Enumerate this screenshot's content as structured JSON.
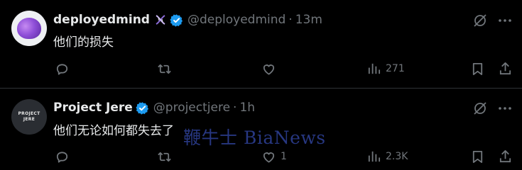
{
  "tweets": [
    {
      "display_name": "deployedmind",
      "handle": "@deployedmind",
      "separator": "·",
      "time": "13m",
      "text": "他们的损失",
      "reply_count": "",
      "retweet_count": "",
      "like_count": "",
      "view_count": "271",
      "avatar": "purple-brain-avatar",
      "name_emoji": "dna-emoji"
    },
    {
      "display_name": "Project Jere",
      "handle": "@projectjere",
      "separator": "·",
      "time": "1h",
      "text": "他们无论如何都失去了",
      "reply_count": "",
      "retweet_count": "",
      "like_count": "1",
      "view_count": "2.3K",
      "avatar_text": [
        "PROJECT",
        "JERE"
      ]
    }
  ],
  "watermark": "鞭牛士 BiaNews",
  "colors": {
    "background": "#000000",
    "text": "#e7e9ea",
    "muted": "#71767b",
    "verified": "#1d9bf0",
    "divider": "#2f3336"
  }
}
